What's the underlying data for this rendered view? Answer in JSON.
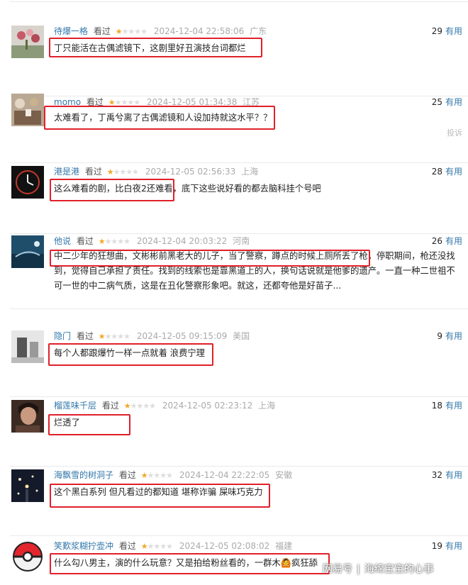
{
  "comments": [
    {
      "user": "待爆一格",
      "watched": "看过",
      "rating": 1,
      "time": "2024-12-04 22:58:06",
      "location": "广东",
      "votes": "29",
      "useful_label": "有用",
      "text": "丁只能活在古偶滤镜下，这剧里好丑演技台词都烂",
      "avatar": "flowers-avatar"
    },
    {
      "user": "momo",
      "watched": "看过",
      "rating": 1,
      "time": "2024-12-05 01:34:38",
      "location": "江苏",
      "votes": "25",
      "useful_label": "有用",
      "text": "太难看了，丁禹兮离了古偶滤镜和人设加持就这水平？？",
      "report": "投诉",
      "avatar": "cafe-avatar"
    },
    {
      "user": "港是港",
      "watched": "看过",
      "rating": 1,
      "time": "2024-12-05 02:56:33",
      "location": "上海",
      "votes": "28",
      "useful_label": "有用",
      "text": "这么难看的剧，比白夜2还难看，底下这些说好看的都去脑科挂个号吧",
      "avatar": "clock-avatar"
    },
    {
      "user": "他说",
      "watched": "看过",
      "rating": 1,
      "time": "2024-12-04 20:03:22",
      "location": "河南",
      "votes": "26",
      "useful_label": "有用",
      "text": "中二少年的狂想曲，文彬彬前黑老大的儿子，当了警察，蹲点的时候上厕所丢了枪，停职期间，枪还没找到，觉得自己承担了责任。找到的线索也是靠黑道上的人，换句话说就是他爹的遗产。一直一种二世祖不可一世的中二病气质，这是在丑化警察形象吧。就这，还都夸他是好苗子...",
      "avatar": "ocean-avatar"
    },
    {
      "user": "隐门",
      "watched": "看过",
      "rating": 1,
      "time": "2024-12-05 09:15:09",
      "location": "美国",
      "votes": "9",
      "useful_label": "有用",
      "text": "每个人都跟爆竹一样一点就着 浪费宁理",
      "avatar": "bw-photo-avatar"
    },
    {
      "user": "榴莲味千层",
      "watched": "看过",
      "rating": 1,
      "time": "2024-12-05 02:23:12",
      "location": "上海",
      "votes": "18",
      "useful_label": "有用",
      "text": "烂透了",
      "avatar": "portrait-avatar"
    },
    {
      "user": "海飘雪的树洞子",
      "watched": "看过",
      "rating": 1,
      "time": "2024-12-04 22:22:05",
      "location": "安徽",
      "votes": "32",
      "useful_label": "有用",
      "text": "这个黑白系列 但凡看过的都知道 堪称诈骗 屎味巧克力",
      "avatar": "sparkle-avatar"
    },
    {
      "user": "笑歎浆糊拧壶冲",
      "watched": "看过",
      "rating": 1,
      "time": "2024-12-05 02:08:02",
      "location": "福建",
      "votes": "19",
      "useful_label": "有用",
      "text": "什么勾八男主，演的什么玩意？又是拍给粉丝看的，一群木🙆疯狂舔",
      "avatar": "pokeball-avatar"
    }
  ],
  "watermark": {
    "platform": "网易号",
    "author": "海绵宝宝的心事",
    "separator": "|"
  },
  "colors": {
    "username": "#3377aa",
    "star_on": "#f5a623",
    "star_off": "#dddddd",
    "highlight": "#e0202a",
    "muted": "#aaaaaa"
  }
}
